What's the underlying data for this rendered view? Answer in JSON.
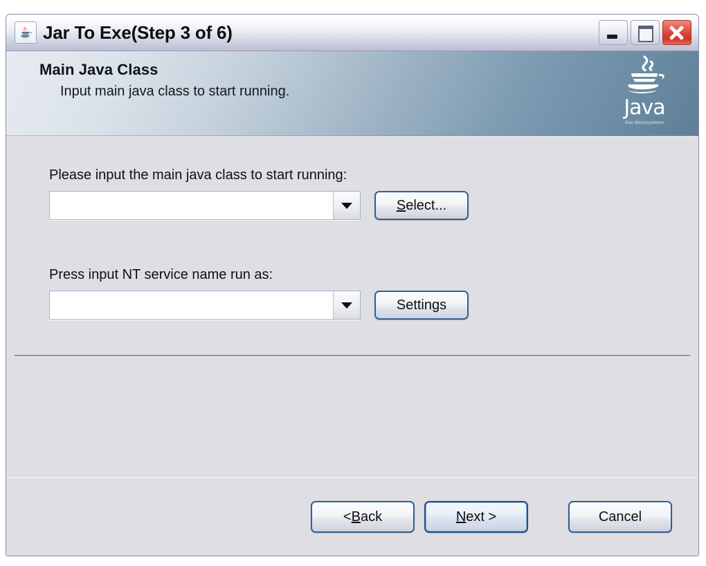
{
  "window": {
    "title": "Jar To Exe(Step 3 of 6)",
    "icon": "java-cup-icon",
    "controls": {
      "minimize": "minimize-button",
      "maximize": "maximize-button",
      "close": "close-button"
    }
  },
  "banner": {
    "title": "Main Java Class",
    "subtitle": "Input main java class to start running.",
    "logo": {
      "wordmark": "Java",
      "tagline": "Sun Microsystems"
    }
  },
  "form": {
    "fields": [
      {
        "label": "Please input the main java class to start running:",
        "value": "",
        "placeholder": "",
        "button": "Select...",
        "button_mnemonic": "S"
      },
      {
        "label": "Press input NT service name run as:",
        "value": "",
        "placeholder": "",
        "button": "Settings",
        "button_mnemonic": ""
      }
    ]
  },
  "footer": {
    "back": "< Back",
    "back_mnemonic": "B",
    "next": "Next >",
    "next_mnemonic": "N",
    "cancel": "Cancel"
  },
  "colors": {
    "panel": "#dedee3",
    "banner_light": "#e6ebf0",
    "banner_dark": "#607f96",
    "button_border": "#2f5f93",
    "default_button_border": "#1c4f8c",
    "close_red": "#cf3526",
    "combo_border": "#9fb4cd"
  }
}
